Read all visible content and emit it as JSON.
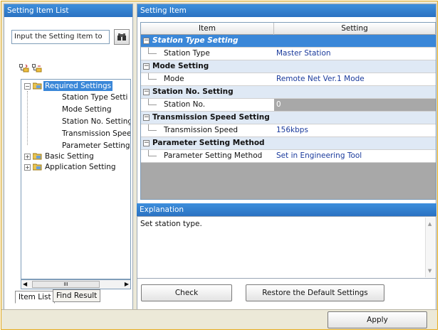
{
  "left_pane": {
    "title": "Setting Item List",
    "search_placeholder": "Input the Setting Item to",
    "tree": {
      "required": "Required Settings",
      "required_children": [
        "Station Type Setti",
        "Mode Setting",
        "Station No. Setting",
        "Transmission Spee",
        "Parameter Setting"
      ],
      "basic": "Basic Setting",
      "application": "Application Setting"
    },
    "scroll_label": "III",
    "tabs": [
      "Item List",
      "Find Result"
    ]
  },
  "right_pane": {
    "title": "Setting Item",
    "columns": [
      "Item",
      "Setting"
    ],
    "groups": [
      {
        "name": "Station Type Setting",
        "item": "Station Type",
        "value": "Master Station"
      },
      {
        "name": "Mode Setting",
        "item": "Mode",
        "value": "Remote Net Ver.1 Mode"
      },
      {
        "name": "Station No. Setting",
        "item": "Station No.",
        "value": "0"
      },
      {
        "name": "Transmission Speed Setting",
        "item": "Transmission Speed",
        "value": "156kbps"
      },
      {
        "name": "Parameter Setting Method",
        "item": "Parameter Setting Method",
        "value": "Set in Engineering Tool"
      }
    ],
    "explanation_title": "Explanation",
    "explanation_text": "Set station type."
  },
  "buttons": {
    "check": "Check",
    "restore": "Restore the Default Settings",
    "apply": "Apply"
  },
  "colors": {
    "title_bar": "#2a72c2",
    "selected_row": "#3a87d8",
    "category_row": "#dfe9f5",
    "value_text": "#1a3a9c",
    "frame_border": "#e3a818"
  }
}
